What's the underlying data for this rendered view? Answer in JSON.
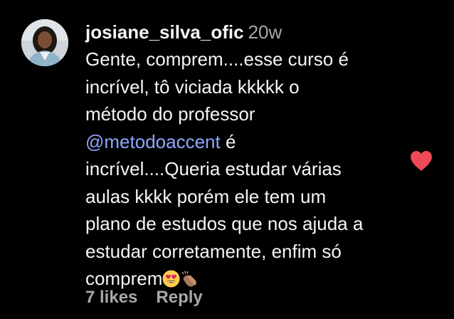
{
  "comment": {
    "username": "josiane_silva_ofic",
    "timestamp": "20w",
    "text_before_mention": "Gente, comprem....esse curso é\nincrível, tô viciada kkkkk o\nmétodo do professor\n",
    "mention": "@metodoaccent",
    "text_after_mention": " é\nincrível....Queria estudar várias\naulas kkkk porém ele tem um\nplano de estudos que nos ajuda a\nestudar corretamente, enfim só\ncomprem",
    "emojis": [
      "heart-eyes-emoji",
      "clapping-hands-emoji"
    ],
    "likes_label": "7 likes",
    "reply_label": "Reply",
    "liked": true
  },
  "colors": {
    "background": "#000000",
    "text": "#f5f5f5",
    "secondary_text": "#a8a8a8",
    "mention": "#8ea7ff",
    "like_heart": "#ed4956"
  }
}
